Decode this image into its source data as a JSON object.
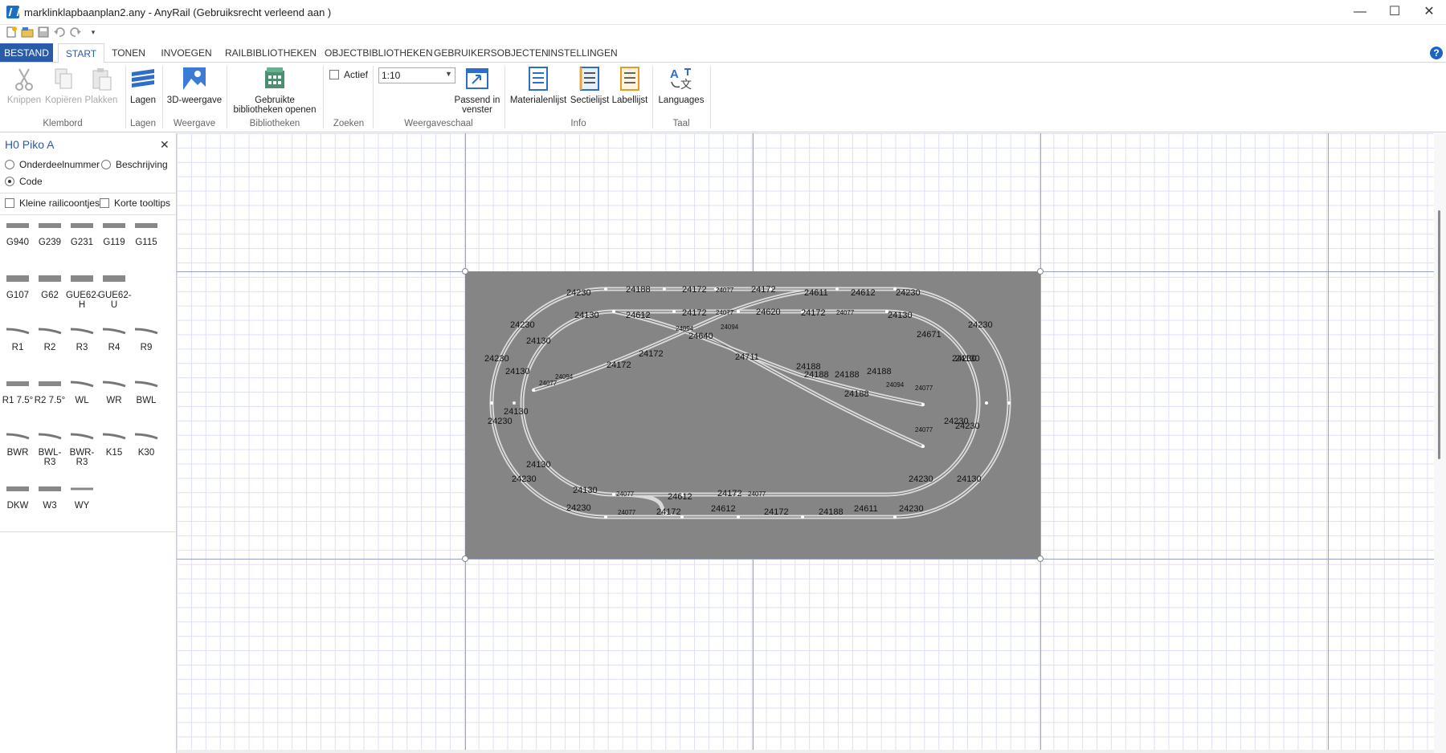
{
  "window": {
    "title": "marklinklapbaanplan2.any - AnyRail (Gebruiksrecht verleend aan )",
    "controls": [
      "—",
      "☐",
      "✕"
    ]
  },
  "quick_access": [
    "new-icon",
    "open-icon",
    "save-icon",
    "undo-icon",
    "redo-icon",
    "customize-icon"
  ],
  "tabs": [
    {
      "label": "BESTAND"
    },
    {
      "label": "START"
    },
    {
      "label": "TONEN"
    },
    {
      "label": "INVOEGEN"
    },
    {
      "label": "RAILBIBLIOTHEKEN"
    },
    {
      "label": "OBJECTBIBLIOTHEKEN"
    },
    {
      "label": "GEBRUIKERSOBJECTEN"
    },
    {
      "label": "INSTELLINGEN"
    }
  ],
  "help_label": "?",
  "ribbon": {
    "knippen": "Knippen",
    "kopieren": "Kopiëren",
    "plakken": "Plakken",
    "klembord": "Klembord",
    "lagen_btn": "Lagen",
    "lagen_group": "Lagen",
    "weergave3d": "3D-weergave",
    "weergave_group": "Weergave",
    "bibliotheken_btn_1": "Gebruikte",
    "bibliotheken_btn_2": "bibliotheken openen",
    "bibliotheken_group": "Bibliotheken",
    "actief": "Actief",
    "zoeken_group": "Zoeken",
    "scale_value": "1:10",
    "passend_1": "Passend in",
    "passend_2": "venster",
    "weergaveschaal_group": "Weergaveschaal",
    "materialenlijst": "Materialenlijst",
    "sectielijst": "Sectielijst",
    "labellijst": "Labellijst",
    "info_group": "Info",
    "languages": "Languages",
    "taal_group": "Taal"
  },
  "panel": {
    "title": "H0 Piko A",
    "close": "✕",
    "radio_onderdeel": "Onderdeelnummer",
    "radio_beschrijving": "Beschrijving",
    "radio_code": "Code",
    "check_kleine": "Kleine railicoontjes",
    "check_korte": "Korte tooltips",
    "rails": [
      {
        "label": "G940"
      },
      {
        "label": "G239"
      },
      {
        "label": "G231"
      },
      {
        "label": "G119"
      },
      {
        "label": "G115"
      },
      {
        "label": "G107"
      },
      {
        "label": "G62"
      },
      {
        "label": "GUE62-H"
      },
      {
        "label": "GUE62-U"
      },
      {
        "label": "R1"
      },
      {
        "label": "R2"
      },
      {
        "label": "R3"
      },
      {
        "label": "R4"
      },
      {
        "label": "R9"
      },
      {
        "label": "R1 7.5°"
      },
      {
        "label": "R2 7.5°"
      },
      {
        "label": "WL"
      },
      {
        "label": "WR"
      },
      {
        "label": "BWL"
      },
      {
        "label": "BWR"
      },
      {
        "label": "BWL-R3"
      },
      {
        "label": "BWR-R3"
      },
      {
        "label": "K15"
      },
      {
        "label": "K30"
      },
      {
        "label": "DKW"
      },
      {
        "label": "W3"
      },
      {
        "label": "WY"
      }
    ]
  },
  "track_labels": {
    "outer_top": [
      "24230",
      "24188",
      "24172",
      "24077",
      "24172",
      "24611",
      "24612",
      "24230"
    ],
    "inner_top": [
      "24130",
      "24612",
      "24172",
      "24077",
      "24620",
      "24172",
      "24077",
      "24130"
    ],
    "left": [
      "24230",
      "24130",
      "24230",
      "24130",
      "24230",
      "24130",
      "24130",
      "24230"
    ],
    "right": [
      "24230",
      "24671",
      "24130",
      "24230",
      "24230",
      "24130",
      "24230",
      "24230"
    ],
    "diagonal": [
      "24094",
      "24094",
      "24640",
      "24172",
      "24172",
      "24094",
      "24077",
      "24711",
      "24188",
      "24188",
      "24188",
      "24188",
      "24188",
      "24094",
      "24077",
      "24077"
    ],
    "inner_bottom": [
      "24130",
      "24077",
      "24612",
      "24172",
      "24077"
    ],
    "outer_bottom": [
      "24230",
      "24077",
      "24172",
      "24612",
      "24172",
      "24188",
      "24611",
      "24230"
    ]
  }
}
